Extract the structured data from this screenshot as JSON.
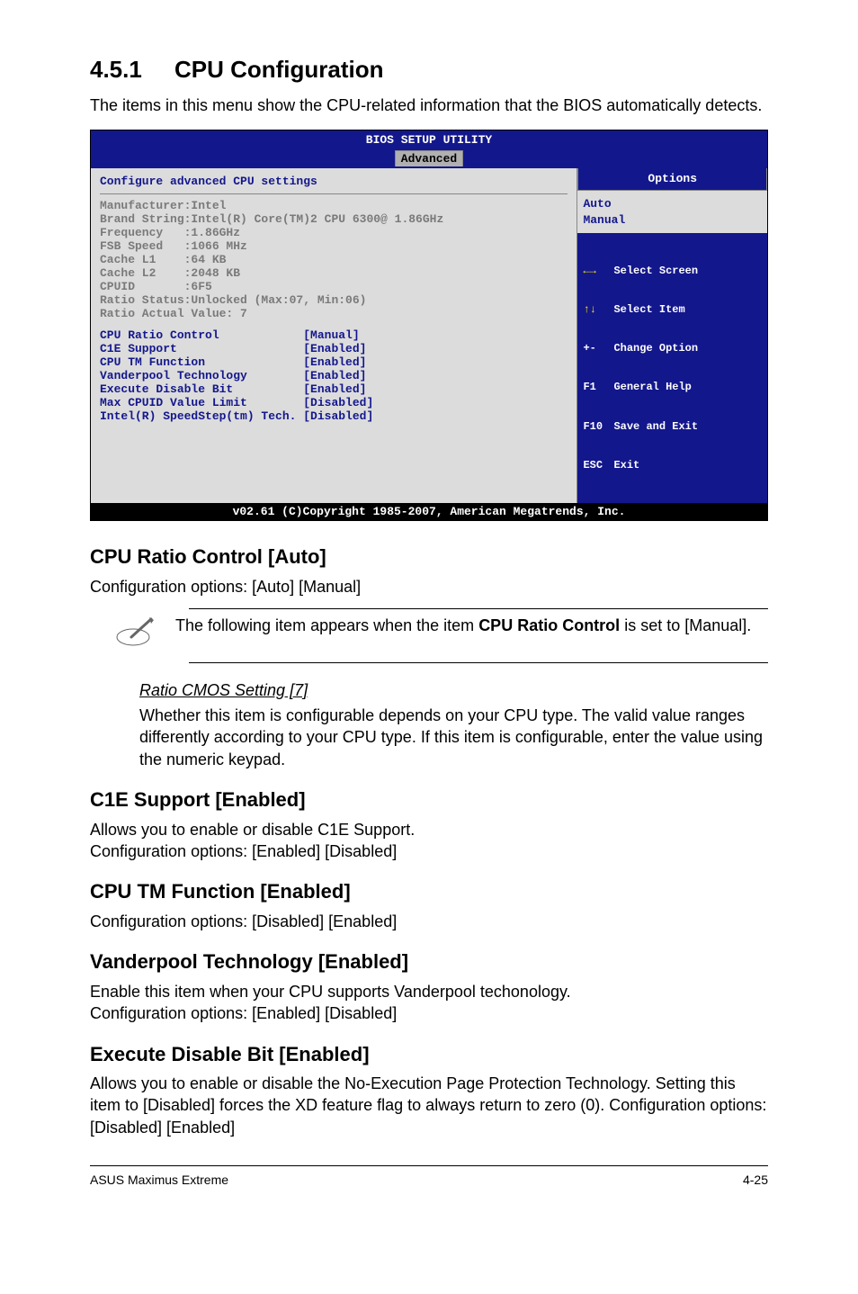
{
  "section": {
    "number": "4.5.1",
    "title": "CPU Configuration",
    "intro": "The items in this menu show the CPU-related information that the BIOS automatically detects."
  },
  "bios": {
    "header": "BIOS SETUP UTILITY",
    "tab": "Advanced",
    "subtitle": "Configure advanced CPU settings",
    "footer": "v02.61 (C)Copyright 1985-2007, American Megatrends, Inc.",
    "info_block": "Manufacturer:Intel\nBrand String:Intel(R) Core(TM)2 CPU 6300@ 1.86GHz\nFrequency   :1.86GHz\nFSB Speed   :1066 MHz\nCache L1    :64 KB\nCache L2    :2048 KB\nCPUID       :6F5\nRatio Status:Unlocked (Max:07, Min:06)\nRatio Actual Value: 7",
    "settings_block": "CPU Ratio Control            [Manual]\nC1E Support                  [Enabled]\nCPU TM Function              [Enabled]\nVanderpool Technology        [Enabled]\nExecute Disable Bit          [Enabled]\nMax CPUID Value Limit        [Disabled]\nIntel(R) SpeedStep(tm) Tech. [Disabled]",
    "options_header": "Options",
    "options_body": "Auto\nManual",
    "hints": {
      "ss": "Select Screen",
      "si": "Select Item",
      "co": "Change Option",
      "gh": "General Help",
      "se": "Save and Exit",
      "ex": "Exit",
      "k_pm": "+-",
      "k_f1": "F1",
      "k_f10": "F10",
      "k_esc": "ESC"
    }
  },
  "settings": {
    "cpu_ratio": {
      "title": "CPU Ratio Control [Auto]",
      "text": "Configuration options: [Auto] [Manual]"
    },
    "note": {
      "prefix": "The following item appears when the item ",
      "bold": "CPU Ratio Control",
      "suffix": " is set to [Manual]."
    },
    "ratio_cmos": {
      "title": "Ratio CMOS Setting [7]",
      "text": "Whether this item is configurable depends on your CPU type. The valid value ranges differently according to your CPU type. If this item is configurable, enter the value using the numeric keypad."
    },
    "c1e": {
      "title": "C1E Support [Enabled]",
      "line1": "Allows you to enable or disable C1E Support.",
      "line2": "Configuration options: [Enabled] [Disabled]"
    },
    "cpu_tm": {
      "title": "CPU TM Function [Enabled]",
      "text": "Configuration options: [Disabled] [Enabled]"
    },
    "vanderpool": {
      "title": "Vanderpool Technology [Enabled]",
      "line1": "Enable this item when your CPU supports Vanderpool techonology.",
      "line2": "Configuration options: [Enabled] [Disabled]"
    },
    "exec_disable": {
      "title": "Execute Disable Bit [Enabled]",
      "text": "Allows you to enable or disable the No-Execution Page Protection Technology. Setting this item to [Disabled] forces the XD feature flag to always return to zero (0). Configuration options: [Disabled] [Enabled]"
    }
  },
  "footer": {
    "left": "ASUS Maximus Extreme",
    "right": "4-25"
  }
}
